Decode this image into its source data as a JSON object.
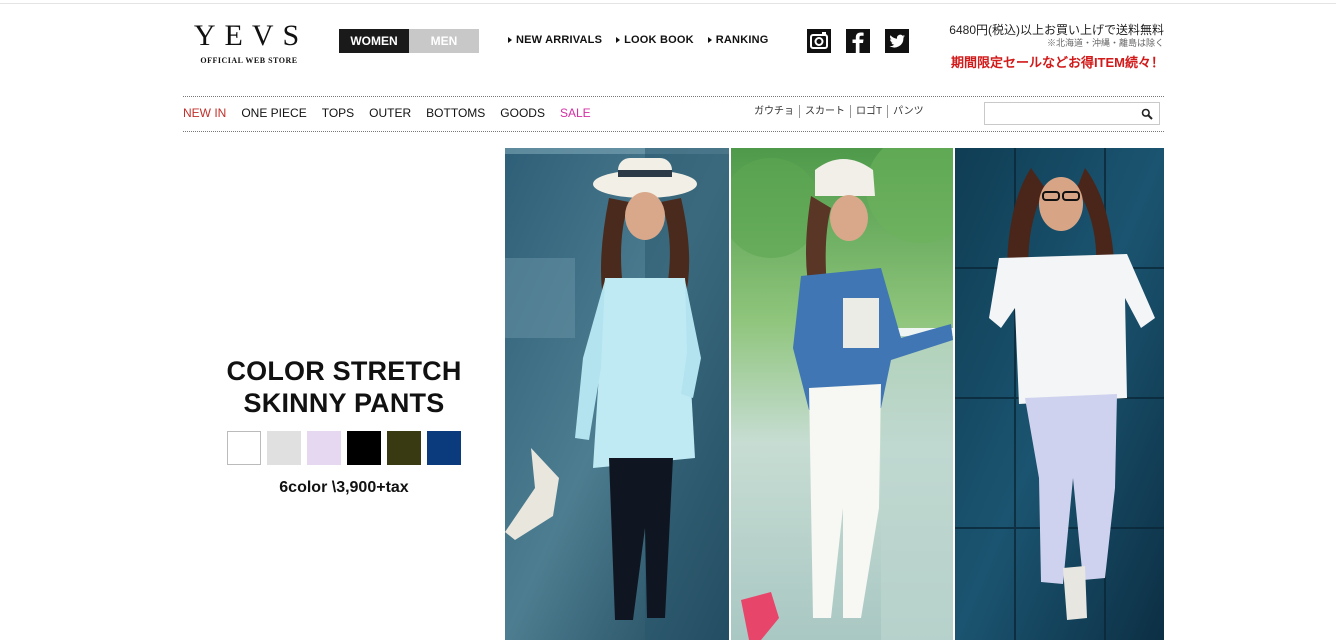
{
  "logo": {
    "mark": "YEVS",
    "sub": "OFFICIAL WEB STORE"
  },
  "gender": {
    "women": "WOMEN",
    "men": "MEN"
  },
  "topnav": [
    "NEW ARRIVALS",
    "LOOK BOOK",
    "RANKING"
  ],
  "social": [
    "instagram-icon",
    "facebook-icon",
    "twitter-icon"
  ],
  "promo": {
    "line1": "6480円(税込)以上お買い上げで送料無料",
    "line2": "※北海道・沖縄・離島は除く",
    "line3": "期間限定セールなどお得ITEM続々！"
  },
  "catnav": [
    "NEW IN",
    "ONE PIECE",
    "TOPS",
    "OUTER",
    "BOTTOMS",
    "GOODS",
    "SALE"
  ],
  "tags": [
    "ガウチョ",
    "スカート",
    "ロゴT",
    "パンツ"
  ],
  "search": {
    "value": "",
    "placeholder": ""
  },
  "feature": {
    "title_line1": "COLOR STRETCH",
    "title_line2": "SKINNY PANTS",
    "price": "6color \\3,900+tax",
    "swatches": [
      "#ffffff",
      "#e0e0e0",
      "#e6d8f0",
      "#000000",
      "#3a3a12",
      "#0b3a7d"
    ]
  },
  "colors": {
    "accent_red": "#c0302a",
    "sale_pink": "#d42fa3",
    "promo_red": "#d21a1a"
  }
}
